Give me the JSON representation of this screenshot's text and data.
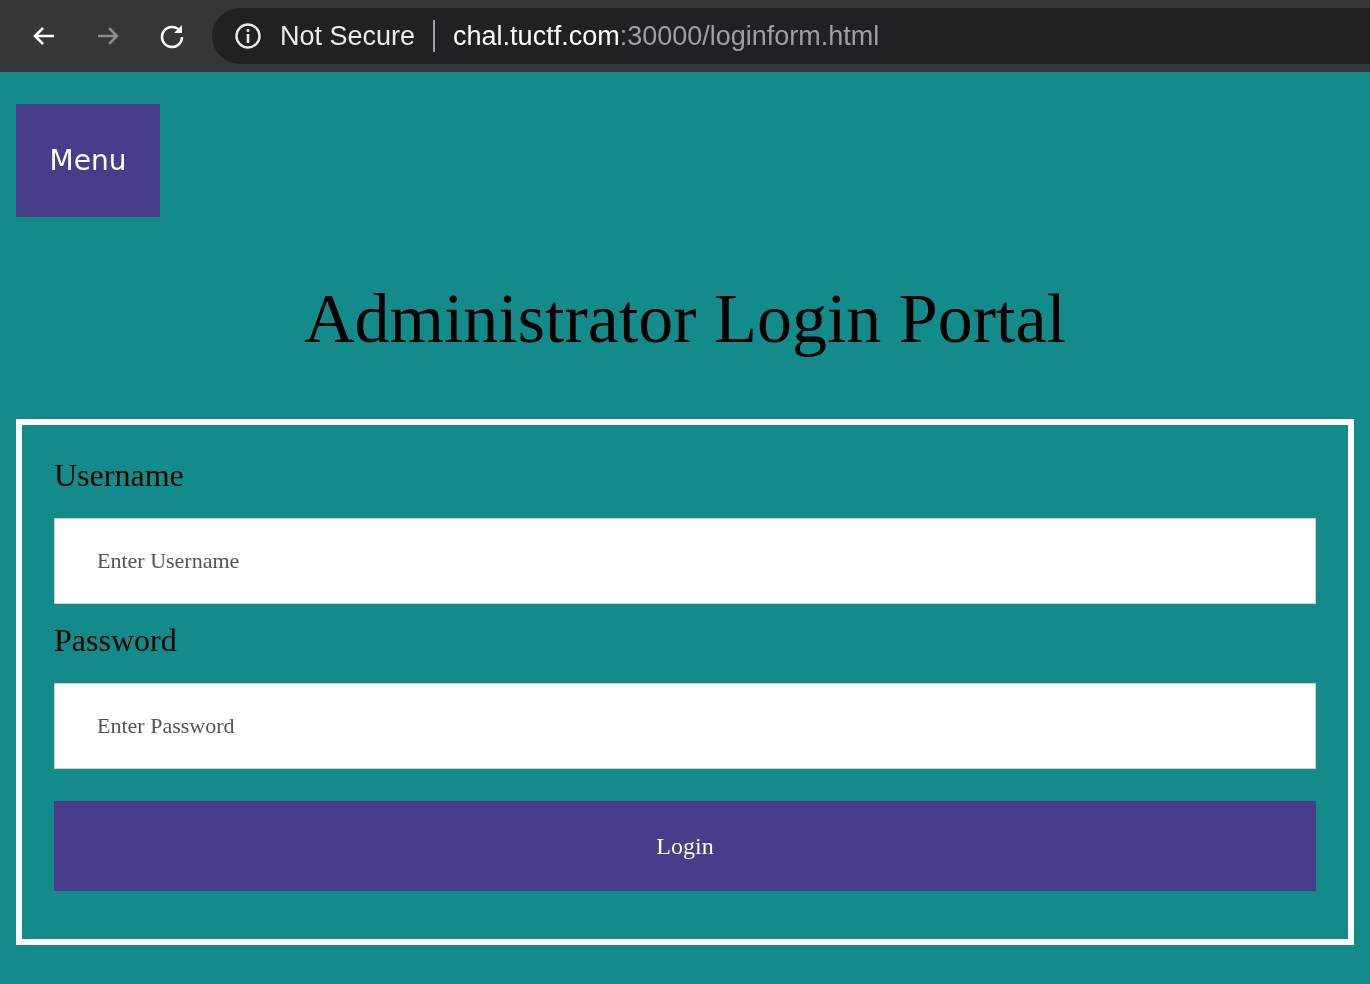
{
  "browser": {
    "nav_buttons": [
      {
        "kind": "back",
        "disabled": false
      },
      {
        "kind": "forward",
        "disabled": true
      },
      {
        "kind": "reload",
        "disabled": false
      }
    ],
    "security_label": "Not Secure",
    "url_host": "chal.tuctf.com",
    "url_path": ":30000/loginform.html"
  },
  "menu_button": "Menu",
  "title": "Administrator Login Portal",
  "form": {
    "fields": [
      {
        "label": "Username",
        "placeholder": "Enter Username"
      },
      {
        "label": "Password",
        "placeholder": "Enter Password"
      }
    ],
    "submit": "Login"
  }
}
